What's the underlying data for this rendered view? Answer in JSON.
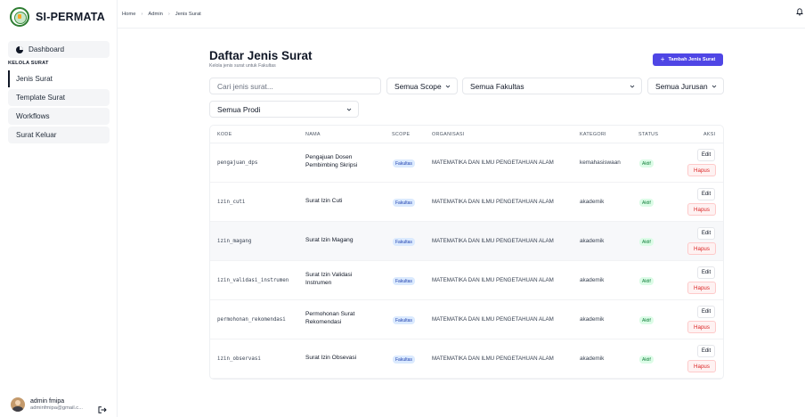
{
  "app": {
    "name": "SI-PERMATA"
  },
  "sidebar": {
    "dashboard": "Dashboard",
    "section_label": "KELOLA SURAT",
    "items": [
      {
        "label": "Jenis Surat",
        "active": true
      },
      {
        "label": "Template Surat",
        "active": false
      },
      {
        "label": "Workflows",
        "active": false
      },
      {
        "label": "Surat Keluar",
        "active": false
      }
    ],
    "user": {
      "name": "admin fmipa",
      "email": "adminfmipa@gmail.c..."
    }
  },
  "breadcrumb": [
    "Home",
    "Admin",
    "Jenis Surat"
  ],
  "page": {
    "title": "Daftar Jenis Surat",
    "subtitle": "Kelola jenis surat untuk Fakultas",
    "add_button": "Tambah Jenis Surat"
  },
  "filters": {
    "search_placeholder": "Cari jenis surat...",
    "scope": "Semua Scope",
    "fakultas": "Semua Fakultas",
    "jurusan": "Semua Jurusan",
    "prodi": "Semua Prodi"
  },
  "table": {
    "headers": [
      "KODE",
      "NAMA",
      "SCOPE",
      "ORGANISASI",
      "KATEGORI",
      "STATUS",
      "AKSI"
    ],
    "rows": [
      {
        "kode": "pengajuan_dps",
        "nama": "Pengajuan Dosen Pembimbing Skripsi",
        "scope": "Fakultas",
        "organisasi": "MATEMATIKA DAN ILMU PENGETAHUAN ALAM",
        "kategori": "kemahasiswaan",
        "status": "Aktif"
      },
      {
        "kode": "izin_cuti",
        "nama": "Surat Izin Cuti",
        "scope": "Fakultas",
        "organisasi": "MATEMATIKA DAN ILMU PENGETAHUAN ALAM",
        "kategori": "akademik",
        "status": "Aktif"
      },
      {
        "kode": "izin_magang",
        "nama": "Surat Izin Magang",
        "scope": "Fakultas",
        "organisasi": "MATEMATIKA DAN ILMU PENGETAHUAN ALAM",
        "kategori": "akademik",
        "status": "Aktif"
      },
      {
        "kode": "izin_validasi_instrumen",
        "nama": "Surat Izin Validasi Instrumen",
        "scope": "Fakultas",
        "organisasi": "MATEMATIKA DAN ILMU PENGETAHUAN ALAM",
        "kategori": "akademik",
        "status": "Aktif"
      },
      {
        "kode": "permohonan_rekomendasi",
        "nama": "Permohonan Surat Rekomendasi",
        "scope": "Fakultas",
        "organisasi": "MATEMATIKA DAN ILMU PENGETAHUAN ALAM",
        "kategori": "akademik",
        "status": "Aktif"
      },
      {
        "kode": "izin_observasi",
        "nama": "Surat Izin Obsevasi",
        "scope": "Fakultas",
        "organisasi": "MATEMATIKA DAN ILMU PENGETAHUAN ALAM",
        "kategori": "akademik",
        "status": "Aktif"
      }
    ],
    "actions": {
      "edit": "Edit",
      "delete": "Hapus"
    }
  },
  "colors": {
    "accent": "#4f46e5",
    "status_bg": "#dcfce7",
    "scope_bg": "#dbeafe",
    "danger": "#dc2626"
  }
}
